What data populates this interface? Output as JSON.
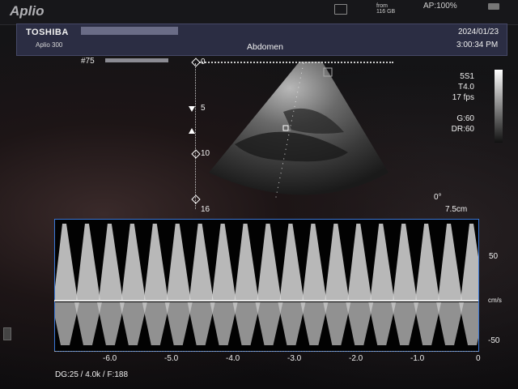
{
  "app": {
    "brand": "Aplio",
    "ap": "AP:100%",
    "hdd_label": "from",
    "hdd_value": "116 GB"
  },
  "header": {
    "manufacturer": "TOSHIBA",
    "model": "Aplio 300",
    "exam": "Abdomen",
    "date": "2024/01/23",
    "time": "3:00:34 PM"
  },
  "image": {
    "frame": "#75",
    "probe": "5S1",
    "preset": "T4.0",
    "frame_rate": "17 fps",
    "gain": "G:60",
    "dynamic_range": "DR:60",
    "angle": "0°",
    "depth": "7.5cm",
    "depth_marks": [
      "0",
      "5",
      "10",
      "16"
    ]
  },
  "spectral": {
    "velocity_labels": [
      "50",
      "cm/s",
      "-50"
    ],
    "time_labels": [
      "-6.0",
      "-5.0",
      "-4.0",
      "-3.0",
      "-2.0",
      "-1.0",
      "0"
    ],
    "status": "DG:25  / 4.0k   / F:188"
  },
  "colors": {
    "header_bg": "#2b2d43",
    "doppler_border": "#3a78d8"
  }
}
